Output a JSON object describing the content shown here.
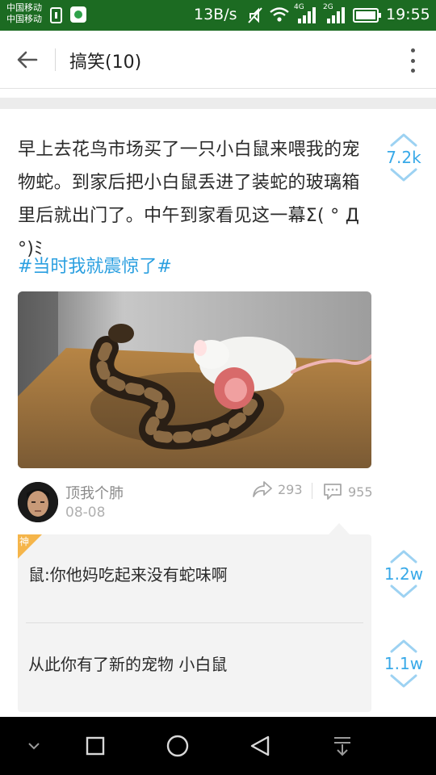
{
  "status_bar": {
    "carrier_1": "中国移动",
    "carrier_2": "中国移动",
    "net_speed": "13B/s",
    "net_4g": "4G",
    "net_2g": "2G",
    "time": "19:55",
    "icons": [
      "sim-icon",
      "app-notification-icon",
      "mute-icon",
      "wifi-icon",
      "signal-icon",
      "battery-icon"
    ]
  },
  "header": {
    "title": "搞笑(10)"
  },
  "post": {
    "text": "早上去花鸟市场买了一只小白鼠来喂我的宠物蛇。到家后把小白鼠丢进了装蛇的玻璃箱里后就出门了。中午到家看见这一幕Σ( ° Д °)ﾐ",
    "hashtag": "#当时我就震惊了#",
    "vote_count": "7.2k",
    "username": "顶我个肺",
    "date": "08-08",
    "share_count": "293",
    "comment_count": "955"
  },
  "comments": [
    {
      "text": "鼠:你他妈吃起来没有蛇味啊",
      "vote_count": "1.2w"
    },
    {
      "text": "从此你有了新的宠物 小白鼠",
      "vote_count": "1.1w"
    }
  ],
  "badge": {
    "label": "神"
  },
  "colors": {
    "status_bar": "#1c6b22",
    "accent_blue": "#38a9e8",
    "hashtag": "#2a9fe0",
    "badge": "#f5b54a"
  }
}
